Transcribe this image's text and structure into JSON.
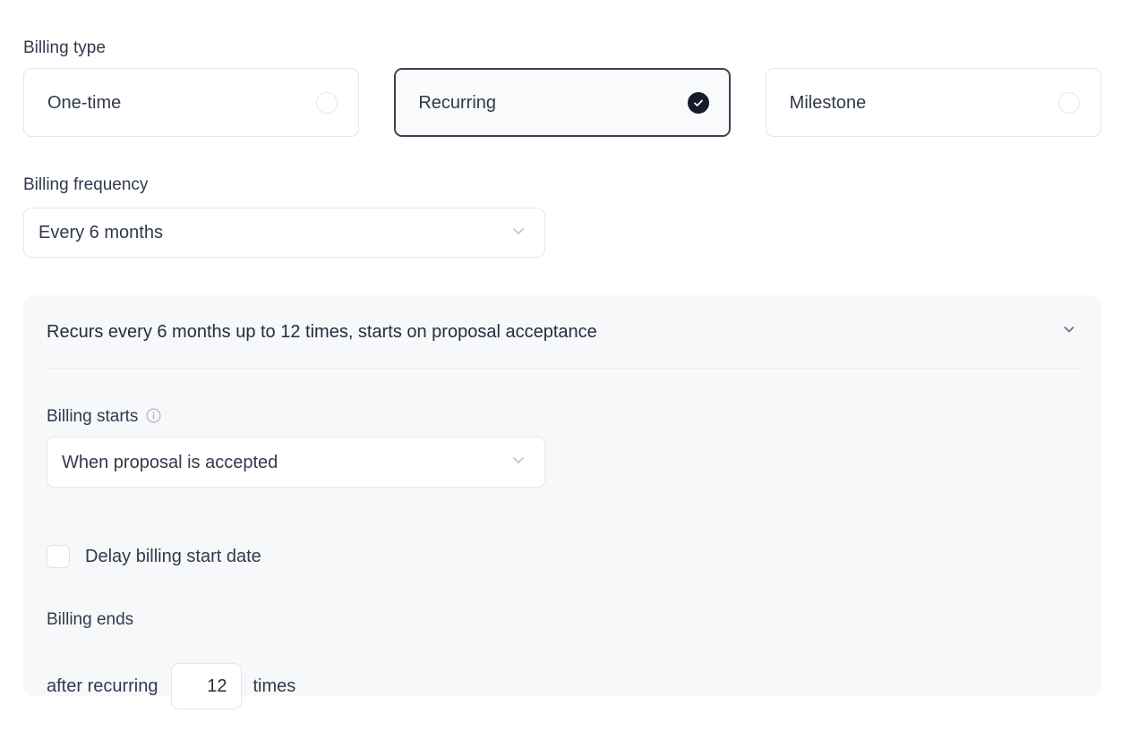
{
  "billing_type": {
    "label": "Billing type",
    "options": [
      {
        "label": "One-time",
        "selected": false
      },
      {
        "label": "Recurring",
        "selected": true
      },
      {
        "label": "Milestone",
        "selected": false
      }
    ],
    "selected_value": "Recurring",
    "selected_border_color": "#3d4553",
    "selected_check_color": "#151b28"
  },
  "billing_frequency": {
    "label": "Billing frequency",
    "value": "Every 6 months",
    "chevron_icon": "chevron-down-icon"
  },
  "recurrence_panel": {
    "summary": "Recurs every 6 months up to 12 times, starts on proposal acceptance",
    "collapse_icon": "chevron-down-icon",
    "background_color": "#f7f8fa",
    "billing_starts": {
      "label": "Billing starts",
      "info_icon": "info-icon",
      "value": "When proposal is accepted",
      "chevron_icon": "chevron-down-icon"
    },
    "delay_checkbox": {
      "label": "Delay billing start date",
      "checked": false
    },
    "billing_ends": {
      "label": "Billing ends",
      "prefix_text": "after recurring",
      "count_value": "12",
      "count_placeholder": "0",
      "suffix_text": "times"
    }
  }
}
